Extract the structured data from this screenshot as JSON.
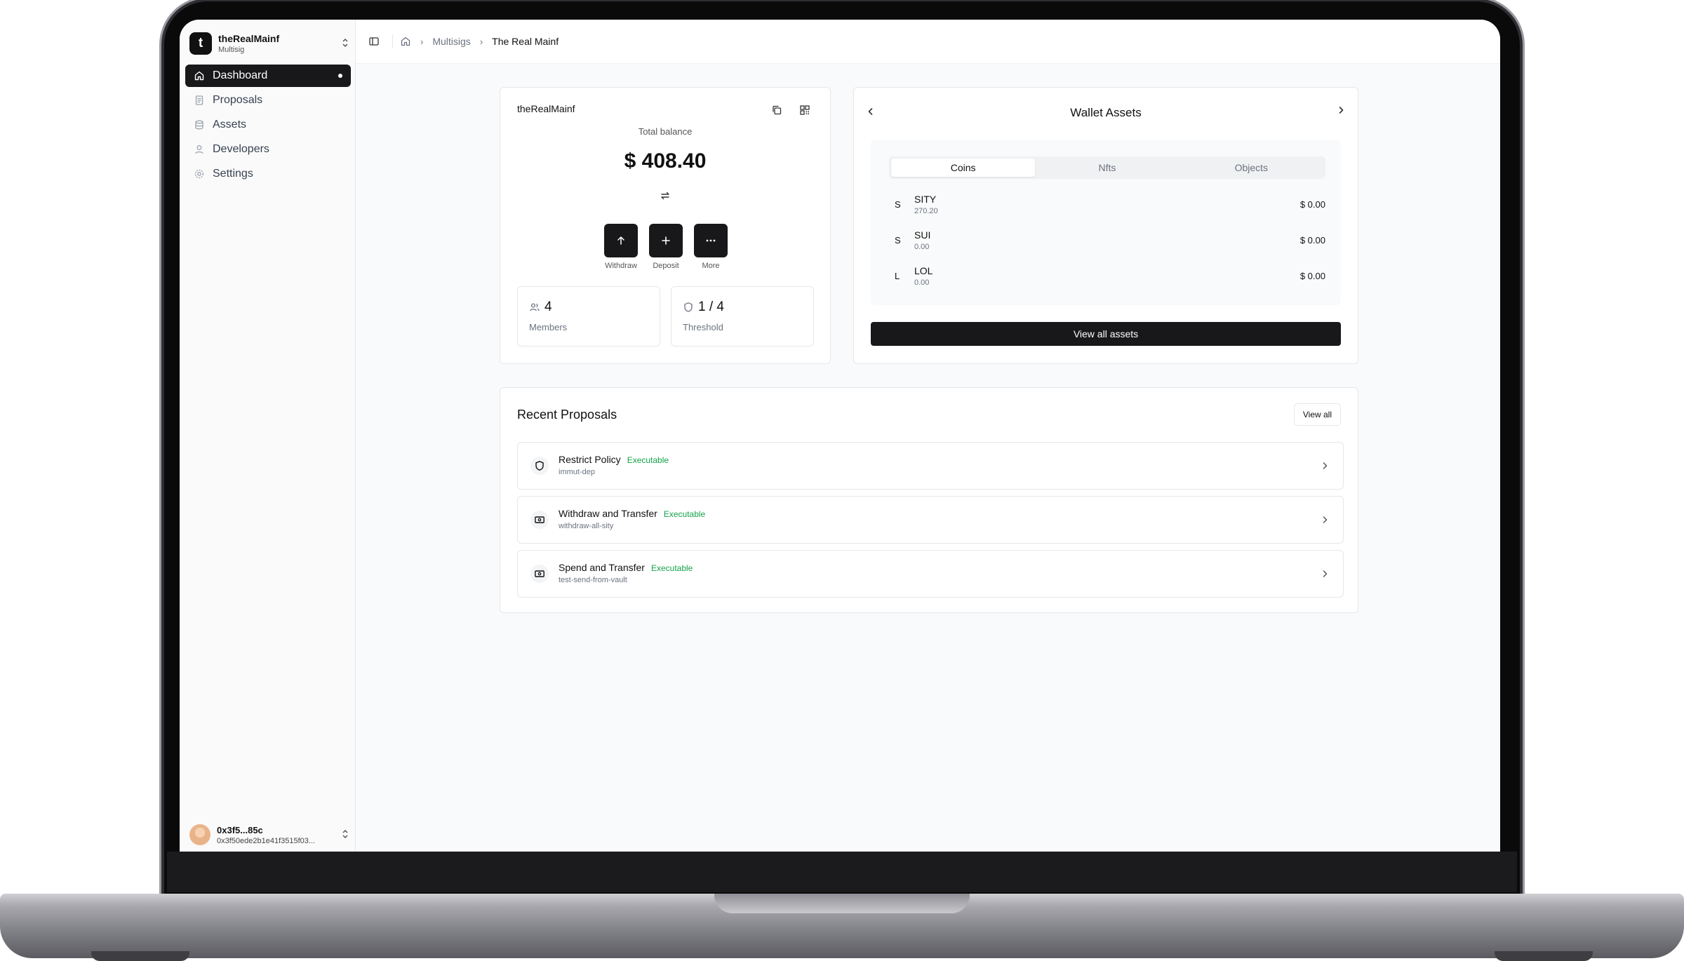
{
  "team": {
    "initial": "t",
    "name": "theRealMainf",
    "subtitle": "Multisig"
  },
  "nav": [
    {
      "label": "Dashboard",
      "icon": "home-icon",
      "active": true
    },
    {
      "label": "Proposals",
      "icon": "document-icon"
    },
    {
      "label": "Assets",
      "icon": "database-icon"
    },
    {
      "label": "Developers",
      "icon": "user-icon"
    },
    {
      "label": "Settings",
      "icon": "gear-icon"
    }
  ],
  "user": {
    "name": "0x3f5...85c",
    "address": "0x3f50ede2b1e41f3515f03..."
  },
  "breadcrumb": {
    "item1": "Multisigs",
    "item2": "The Real Mainf"
  },
  "wallet": {
    "name": "theRealMainf",
    "balance_label": "Total balance",
    "balance_value": "$ 408.40",
    "actions": {
      "withdraw": "Withdraw",
      "deposit": "Deposit",
      "more": "More"
    },
    "members": {
      "value": "4",
      "label": "Members"
    },
    "threshold": {
      "value": "1 / 4",
      "label": "Threshold"
    }
  },
  "assets": {
    "title": "Wallet Assets",
    "tabs": [
      "Coins",
      "Nfts",
      "Objects"
    ],
    "active_tab": "Coins",
    "coins": [
      {
        "letter": "S",
        "name": "SITY",
        "amount": "270.20",
        "usd": "$ 0.00"
      },
      {
        "letter": "S",
        "name": "SUI",
        "amount": "0.00",
        "usd": "$ 0.00"
      },
      {
        "letter": "L",
        "name": "LOL",
        "amount": "0.00",
        "usd": "$ 0.00"
      }
    ],
    "view_all_label": "View all assets"
  },
  "proposals": {
    "title": "Recent Proposals",
    "view_all_label": "View all",
    "items": [
      {
        "name": "Restrict Policy",
        "status": "Executable",
        "sub": "immut-dep",
        "icon": "shield-icon"
      },
      {
        "name": "Withdraw and Transfer",
        "status": "Executable",
        "sub": "withdraw-all-sity",
        "icon": "banknote-icon"
      },
      {
        "name": "Spend and Transfer",
        "status": "Executable",
        "sub": "test-send-from-vault",
        "icon": "banknote-icon"
      }
    ]
  },
  "colors": {
    "primary": "#18181b",
    "status_green": "#16a34a",
    "background": "#f9fafb"
  }
}
